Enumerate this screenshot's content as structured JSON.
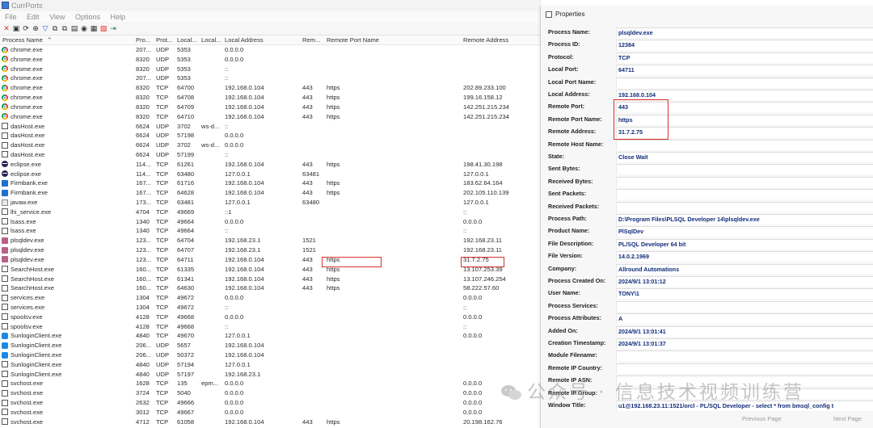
{
  "window": {
    "title": "CurrPorts"
  },
  "menu": [
    "File",
    "Edit",
    "View",
    "Options",
    "Help"
  ],
  "columns": [
    "Process Name",
    "Pro...",
    "Prot...",
    "Local...",
    "Local...",
    "Local Address",
    "Rem...",
    "Remote Port Name",
    "Remote Address"
  ],
  "rows": [
    {
      "icon": "chrome",
      "name": "chrome.exe",
      "pid": "207...",
      "proto": "UDP",
      "lport": "5353",
      "lpname": "",
      "laddr": "0.0.0.0",
      "rport": "",
      "rpname": "",
      "raddr": ""
    },
    {
      "icon": "chrome",
      "name": "chrome.exe",
      "pid": "8320",
      "proto": "UDP",
      "lport": "5353",
      "lpname": "",
      "laddr": "0.0.0.0",
      "rport": "",
      "rpname": "",
      "raddr": ""
    },
    {
      "icon": "chrome",
      "name": "chrome.exe",
      "pid": "8320",
      "proto": "UDP",
      "lport": "5353",
      "lpname": "",
      "laddr": "::",
      "rport": "",
      "rpname": "",
      "raddr": ""
    },
    {
      "icon": "chrome",
      "name": "chrome.exe",
      "pid": "207...",
      "proto": "UDP",
      "lport": "5353",
      "lpname": "",
      "laddr": "::",
      "rport": "",
      "rpname": "",
      "raddr": ""
    },
    {
      "icon": "chrome",
      "name": "chrome.exe",
      "pid": "8320",
      "proto": "TCP",
      "lport": "64700",
      "lpname": "",
      "laddr": "192.168.0.104",
      "rport": "443",
      "rpname": "https",
      "raddr": "202.89.233.100"
    },
    {
      "icon": "chrome",
      "name": "chrome.exe",
      "pid": "8320",
      "proto": "TCP",
      "lport": "64708",
      "lpname": "",
      "laddr": "192.168.0.104",
      "rport": "443",
      "rpname": "https",
      "raddr": "199.16.158.12"
    },
    {
      "icon": "chrome",
      "name": "chrome.exe",
      "pid": "8320",
      "proto": "TCP",
      "lport": "64709",
      "lpname": "",
      "laddr": "192.168.0.104",
      "rport": "443",
      "rpname": "https",
      "raddr": "142.251.215.234"
    },
    {
      "icon": "chrome",
      "name": "chrome.exe",
      "pid": "8320",
      "proto": "TCP",
      "lport": "64710",
      "lpname": "",
      "laddr": "192.168.0.104",
      "rport": "443",
      "rpname": "https",
      "raddr": "142.251.215.234"
    },
    {
      "icon": "generic",
      "name": "dasHost.exe",
      "pid": "6624",
      "proto": "UDP",
      "lport": "3702",
      "lpname": "ws-d...",
      "laddr": "::",
      "rport": "",
      "rpname": "",
      "raddr": ""
    },
    {
      "icon": "generic",
      "name": "dasHost.exe",
      "pid": "6624",
      "proto": "UDP",
      "lport": "57198",
      "lpname": "",
      "laddr": "0.0.0.0",
      "rport": "",
      "rpname": "",
      "raddr": ""
    },
    {
      "icon": "generic",
      "name": "dasHost.exe",
      "pid": "6624",
      "proto": "UDP",
      "lport": "3702",
      "lpname": "ws-d...",
      "laddr": "0.0.0.0",
      "rport": "",
      "rpname": "",
      "raddr": ""
    },
    {
      "icon": "generic",
      "name": "dasHost.exe",
      "pid": "6624",
      "proto": "UDP",
      "lport": "57199",
      "lpname": "",
      "laddr": "::",
      "rport": "",
      "rpname": "",
      "raddr": ""
    },
    {
      "icon": "eclipse",
      "name": "eclipse.exe",
      "pid": "114...",
      "proto": "TCP",
      "lport": "61261",
      "lpname": "",
      "laddr": "192.168.0.104",
      "rport": "443",
      "rpname": "https",
      "raddr": "198.41.30.198"
    },
    {
      "icon": "eclipse",
      "name": "eclipse.exe",
      "pid": "114...",
      "proto": "TCP",
      "lport": "63480",
      "lpname": "",
      "laddr": "127.0.0.1",
      "rport": "63481",
      "rpname": "",
      "raddr": "127.0.0.1"
    },
    {
      "icon": "firm",
      "name": "Firmbank.exe",
      "pid": "167...",
      "proto": "TCP",
      "lport": "61716",
      "lpname": "",
      "laddr": "192.168.0.104",
      "rport": "443",
      "rpname": "https",
      "raddr": "183.62.64.164"
    },
    {
      "icon": "firm",
      "name": "Firmbank.exe",
      "pid": "167...",
      "proto": "TCP",
      "lport": "64628",
      "lpname": "",
      "laddr": "192.168.0.104",
      "rport": "443",
      "rpname": "https",
      "raddr": "202.105.110.139"
    },
    {
      "icon": "java",
      "name": "javaw.exe",
      "pid": "173...",
      "proto": "TCP",
      "lport": "63481",
      "lpname": "",
      "laddr": "127.0.0.1",
      "rport": "63480",
      "rpname": "",
      "raddr": "127.0.0.1"
    },
    {
      "icon": "generic",
      "name": "lhi_service.exe",
      "pid": "4704",
      "proto": "TCP",
      "lport": "49669",
      "lpname": "",
      "laddr": "::1",
      "rport": "",
      "rpname": "",
      "raddr": "::"
    },
    {
      "icon": "generic",
      "name": "lsass.exe",
      "pid": "1340",
      "proto": "TCP",
      "lport": "49664",
      "lpname": "",
      "laddr": "0.0.0.0",
      "rport": "",
      "rpname": "",
      "raddr": "0.0.0.0"
    },
    {
      "icon": "generic",
      "name": "lsass.exe",
      "pid": "1340",
      "proto": "TCP",
      "lport": "49664",
      "lpname": "",
      "laddr": "::",
      "rport": "",
      "rpname": "",
      "raddr": "::"
    },
    {
      "icon": "plsql",
      "name": "plsqldev.exe",
      "pid": "123...",
      "proto": "TCP",
      "lport": "64704",
      "lpname": "",
      "laddr": "192.168.23.1",
      "rport": "1521",
      "rpname": "",
      "raddr": "192.168.23.11"
    },
    {
      "icon": "plsql",
      "name": "plsqldev.exe",
      "pid": "123...",
      "proto": "TCP",
      "lport": "64707",
      "lpname": "",
      "laddr": "192.168.23.1",
      "rport": "1521",
      "rpname": "",
      "raddr": "192.168.23.11"
    },
    {
      "icon": "plsql",
      "name": "plsqldev.exe",
      "pid": "123...",
      "proto": "TCP",
      "lport": "64711",
      "lpname": "",
      "laddr": "192.168.0.104",
      "rport": "443",
      "rpname": "https",
      "raddr": "31.7.2.75"
    },
    {
      "icon": "generic",
      "name": "SearchHost.exe",
      "pid": "160...",
      "proto": "TCP",
      "lport": "61335",
      "lpname": "",
      "laddr": "192.168.0.104",
      "rport": "443",
      "rpname": "https",
      "raddr": "13.107.253.39"
    },
    {
      "icon": "generic",
      "name": "SearchHost.exe",
      "pid": "160...",
      "proto": "TCP",
      "lport": "61341",
      "lpname": "",
      "laddr": "192.168.0.104",
      "rport": "443",
      "rpname": "https",
      "raddr": "13.107.246.254"
    },
    {
      "icon": "generic",
      "name": "SearchHost.exe",
      "pid": "160...",
      "proto": "TCP",
      "lport": "64630",
      "lpname": "",
      "laddr": "192.168.0.104",
      "rport": "443",
      "rpname": "https",
      "raddr": "58.222.57.60"
    },
    {
      "icon": "generic",
      "name": "services.exe",
      "pid": "1304",
      "proto": "TCP",
      "lport": "49672",
      "lpname": "",
      "laddr": "0.0.0.0",
      "rport": "",
      "rpname": "",
      "raddr": "0.0.0.0"
    },
    {
      "icon": "generic",
      "name": "services.exe",
      "pid": "1304",
      "proto": "TCP",
      "lport": "49672",
      "lpname": "",
      "laddr": "::",
      "rport": "",
      "rpname": "",
      "raddr": "::"
    },
    {
      "icon": "generic",
      "name": "spoolsv.exe",
      "pid": "4128",
      "proto": "TCP",
      "lport": "49668",
      "lpname": "",
      "laddr": "0.0.0.0",
      "rport": "",
      "rpname": "",
      "raddr": "0.0.0.0"
    },
    {
      "icon": "generic",
      "name": "spoolsv.exe",
      "pid": "4128",
      "proto": "TCP",
      "lport": "49668",
      "lpname": "",
      "laddr": "::",
      "rport": "",
      "rpname": "",
      "raddr": "::"
    },
    {
      "icon": "sun",
      "name": "SunloginClient.exe",
      "pid": "4840",
      "proto": "TCP",
      "lport": "49670",
      "lpname": "",
      "laddr": "127.0.0.1",
      "rport": "",
      "rpname": "",
      "raddr": "0.0.0.0"
    },
    {
      "icon": "sun",
      "name": "SunloginClient.exe",
      "pid": "206...",
      "proto": "UDP",
      "lport": "5657",
      "lpname": "",
      "laddr": "192.168.0.104",
      "rport": "",
      "rpname": "",
      "raddr": ""
    },
    {
      "icon": "sun",
      "name": "SunloginClient.exe",
      "pid": "206...",
      "proto": "UDP",
      "lport": "50372",
      "lpname": "",
      "laddr": "192.168.0.104",
      "rport": "",
      "rpname": "",
      "raddr": ""
    },
    {
      "icon": "generic",
      "name": "SunloginClient.exe",
      "pid": "4840",
      "proto": "UDP",
      "lport": "57194",
      "lpname": "",
      "laddr": "127.0.0.1",
      "rport": "",
      "rpname": "",
      "raddr": ""
    },
    {
      "icon": "generic",
      "name": "SunloginClient.exe",
      "pid": "4840",
      "proto": "UDP",
      "lport": "57197",
      "lpname": "",
      "laddr": "192.168.23.1",
      "rport": "",
      "rpname": "",
      "raddr": ""
    },
    {
      "icon": "generic",
      "name": "svchost.exe",
      "pid": "1628",
      "proto": "TCP",
      "lport": "135",
      "lpname": "epm...",
      "laddr": "0.0.0.0",
      "rport": "",
      "rpname": "",
      "raddr": "0.0.0.0"
    },
    {
      "icon": "generic",
      "name": "svchost.exe",
      "pid": "3724",
      "proto": "TCP",
      "lport": "5040",
      "lpname": "",
      "laddr": "0.0.0.0",
      "rport": "",
      "rpname": "",
      "raddr": "0.0.0.0"
    },
    {
      "icon": "generic",
      "name": "svchost.exe",
      "pid": "2632",
      "proto": "TCP",
      "lport": "49666",
      "lpname": "",
      "laddr": "0.0.0.0",
      "rport": "",
      "rpname": "",
      "raddr": "0.0.0.0"
    },
    {
      "icon": "generic",
      "name": "svchost.exe",
      "pid": "3012",
      "proto": "TCP",
      "lport": "49667",
      "lpname": "",
      "laddr": "0.0.0.0",
      "rport": "",
      "rpname": "",
      "raddr": "0.0.0.0"
    },
    {
      "icon": "generic",
      "name": "svchost.exe",
      "pid": "4712",
      "proto": "TCP",
      "lport": "61058",
      "lpname": "",
      "laddr": "192.168.0.104",
      "rport": "443",
      "rpname": "https",
      "raddr": "20.198.162.76"
    }
  ],
  "properties": {
    "title": "Properties",
    "fields": [
      {
        "label": "Process Name:",
        "value": "plsqldev.exe"
      },
      {
        "label": "Process ID:",
        "value": "12384"
      },
      {
        "label": "Protocol:",
        "value": "TCP"
      },
      {
        "label": "Local Port:",
        "value": "64711"
      },
      {
        "label": "Local Port Name:",
        "value": ""
      },
      {
        "label": "Local Address:",
        "value": "192.168.0.104"
      },
      {
        "label": "Remote Port:",
        "value": "443"
      },
      {
        "label": "Remote Port Name:",
        "value": "https"
      },
      {
        "label": "Remote Address:",
        "value": "31.7.2.75"
      },
      {
        "label": "Remote Host Name:",
        "value": ""
      },
      {
        "label": "State:",
        "value": "Close Wait"
      },
      {
        "label": "Sent Bytes:",
        "value": ""
      },
      {
        "label": "Received Bytes:",
        "value": ""
      },
      {
        "label": "Sent Packets:",
        "value": ""
      },
      {
        "label": "Received Packets:",
        "value": ""
      },
      {
        "label": "Process Path:",
        "value": "D:\\Program Files\\PLSQL Developer 14\\plsqldev.exe"
      },
      {
        "label": "Product Name:",
        "value": "PlSqlDev"
      },
      {
        "label": "File Description:",
        "value": "PL/SQL Developer 64 bit"
      },
      {
        "label": "File Version:",
        "value": "14.0.2.1969"
      },
      {
        "label": "Company:",
        "value": "Allround Automations"
      },
      {
        "label": "Process Created On:",
        "value": "2024/9/1 13:01:12"
      },
      {
        "label": "User Name:",
        "value": "TONY\\1"
      },
      {
        "label": "Process Services:",
        "value": ""
      },
      {
        "label": "Process Attributes:",
        "value": "A"
      },
      {
        "label": "Added On:",
        "value": "2024/9/1 13:01:41"
      },
      {
        "label": "Creation Timestamp:",
        "value": "2024/9/1 13:01:37"
      },
      {
        "label": "Module Filename:",
        "value": ""
      },
      {
        "label": "Remote IP Country:",
        "value": ""
      },
      {
        "label": "Remote IP ASN:",
        "value": ""
      },
      {
        "label": "Remote IP Group:",
        "value": ""
      },
      {
        "label": "Window Title:",
        "value": "u1@192.168.23.11:1521/orcl - PL/SQL Developer - select * from bmsql_config t"
      }
    ],
    "prev_button": "Previous Page",
    "next_button": "Next Page"
  },
  "watermark": {
    "text": "公众号 · 信息技术视频训练营"
  },
  "colors": {
    "highlight": "#d9312b",
    "value_text": "#122d7a"
  }
}
